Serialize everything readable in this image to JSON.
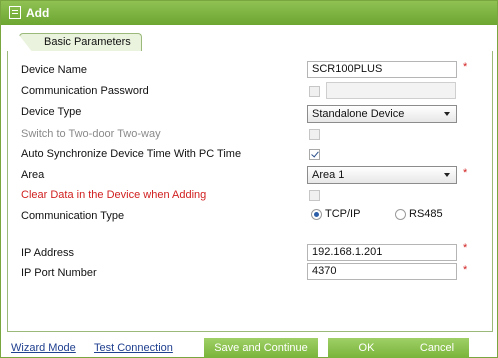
{
  "dialog": {
    "title": "Add"
  },
  "tabs": [
    {
      "label": "Basic Parameters"
    }
  ],
  "form": {
    "device_name": {
      "label": "Device Name",
      "value": "SCR100PLUS",
      "required_mark": "*"
    },
    "comm_password": {
      "label": "Communication Password",
      "checked": false,
      "value": ""
    },
    "device_type": {
      "label": "Device Type",
      "selected": "Standalone Device"
    },
    "two_door": {
      "label": "Switch to Two-door Two-way",
      "checked": false,
      "enabled": false
    },
    "auto_sync": {
      "label": "Auto Synchronize Device Time With PC Time",
      "checked": true
    },
    "area": {
      "label": "Area",
      "selected": "Area 1",
      "required_mark": "*"
    },
    "clear_data": {
      "label": "Clear Data in the Device when Adding",
      "checked": false
    },
    "comm_type": {
      "label": "Communication Type",
      "options": [
        {
          "label": "TCP/IP",
          "selected": true
        },
        {
          "label": "RS485",
          "selected": false
        }
      ]
    },
    "ip_address": {
      "label": "IP Address",
      "value": "192.168.1.201",
      "required_mark": "*"
    },
    "ip_port": {
      "label": "IP Port Number",
      "value": "4370",
      "required_mark": "*"
    }
  },
  "footer": {
    "wizard_mode": "Wizard Mode",
    "test_connection": "Test Connection",
    "save_continue": "Save and Continue",
    "ok": "OK",
    "cancel": "Cancel"
  },
  "colors": {
    "accent": "#7ab440",
    "required": "#d12020",
    "link": "#1f3f8f"
  }
}
